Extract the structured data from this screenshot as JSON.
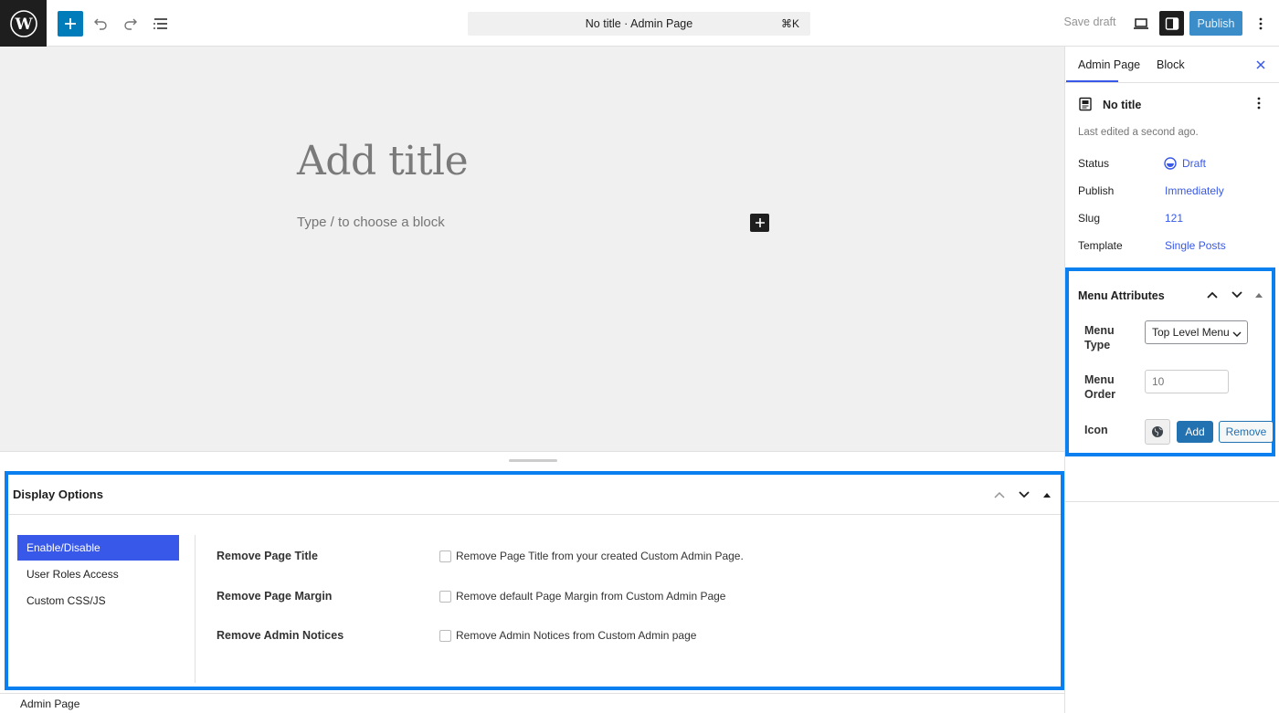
{
  "header": {
    "command_bar": "No title · Admin Page",
    "command_shortcut": "⌘K",
    "save_draft": "Save draft",
    "publish": "Publish"
  },
  "editor": {
    "title_placeholder": "Add title",
    "block_placeholder": "Type / to choose a block"
  },
  "display_options": {
    "title": "Display Options",
    "tabs": [
      "Enable/Disable",
      "User Roles Access",
      "Custom CSS/JS"
    ],
    "active_tab": "Enable/Disable",
    "options": [
      {
        "label": "Remove Page Title",
        "description": "Remove Page Title from your created Custom Admin Page.",
        "checked": false
      },
      {
        "label": "Remove Page Margin",
        "description": "Remove default Page Margin from Custom Admin Page",
        "checked": false
      },
      {
        "label": "Remove Admin Notices",
        "description": "Remove Admin Notices from Custom Admin page",
        "checked": false
      }
    ]
  },
  "footer": {
    "breadcrumb": "Admin Page"
  },
  "sidebar": {
    "tabs": [
      "Admin Page",
      "Block"
    ],
    "post_title": "No title",
    "last_edited": "Last edited a second ago.",
    "properties": [
      {
        "key": "Status",
        "value": "Draft"
      },
      {
        "key": "Publish",
        "value": "Immediately"
      },
      {
        "key": "Slug",
        "value": "121"
      },
      {
        "key": "Template",
        "value": "Single Posts"
      }
    ]
  },
  "menu_attributes": {
    "title": "Menu Attributes",
    "menu_type_label": "Menu Type",
    "menu_type_value": "Top Level Menu",
    "menu_order_label": "Menu Order",
    "menu_order_value": "10",
    "icon_label": "Icon",
    "add_label": "Add",
    "remove_label": "Remove"
  },
  "colors": {
    "accent": "#3858e9",
    "wp_blue": "#007cba",
    "highlight": "#0a7ff0",
    "publish_bg": "#3a8dc9"
  }
}
